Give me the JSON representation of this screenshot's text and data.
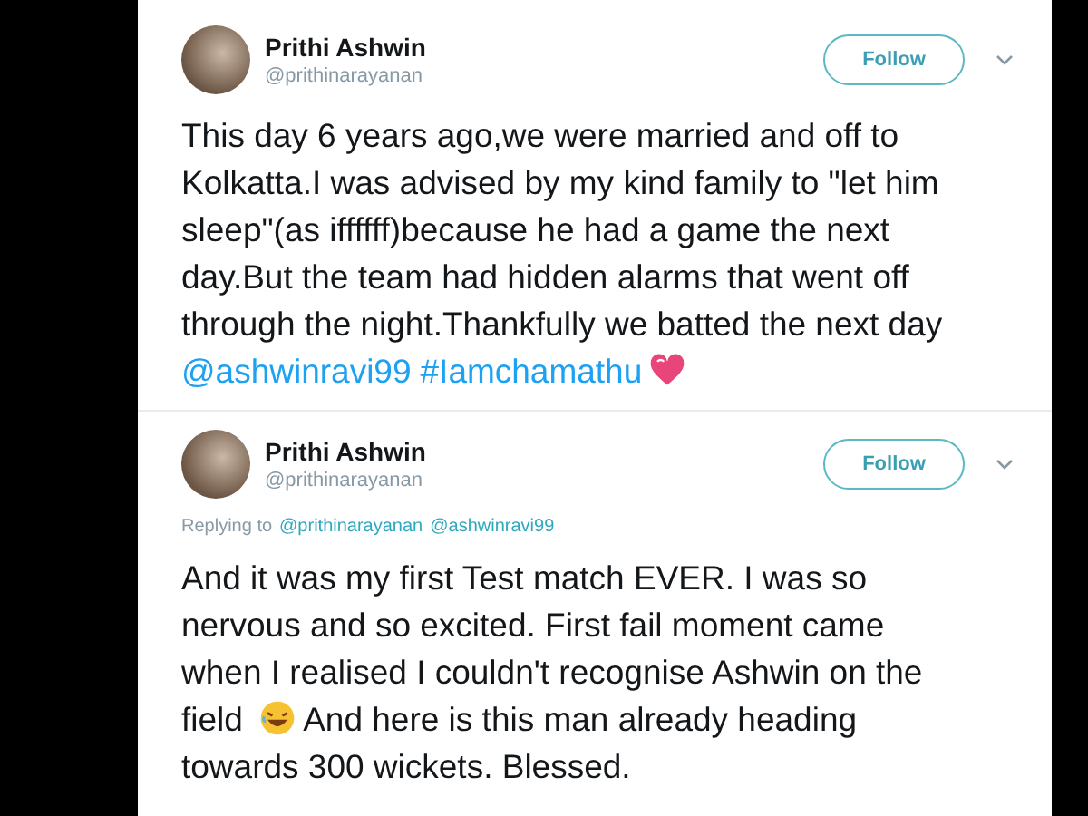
{
  "tweets": [
    {
      "name": "Prithi Ashwin",
      "handle": "@prithinarayanan",
      "follow": "Follow",
      "body": [
        {
          "kind": "text",
          "text": "This day 6 years ago,we were married and off to Kolkatta.I was advised by my kind family to \"let him sleep\"(as iffffff)because he had a game the next day.But the team had hidden alarms that went off through the night.Thankfully we batted the next day "
        },
        {
          "kind": "link",
          "text": "@ashwinravi99"
        },
        {
          "kind": "link",
          "text": "#Iamchamathu"
        },
        {
          "kind": "heart"
        }
      ]
    },
    {
      "name": "Prithi Ashwin",
      "handle": "@prithinarayanan",
      "follow": "Follow",
      "replying": {
        "label": "Replying to",
        "mentions": [
          "@prithinarayanan",
          "@ashwinravi99"
        ]
      },
      "body": [
        {
          "kind": "text",
          "text": "And it was my first Test match EVER. I was so nervous and so excited. First fail moment came when I realised I couldn't recognise Ashwin on the field "
        },
        {
          "kind": "laugh"
        },
        {
          "kind": "text",
          "text": "And here is this man already heading towards 300 wickets. Blessed."
        }
      ]
    }
  ]
}
